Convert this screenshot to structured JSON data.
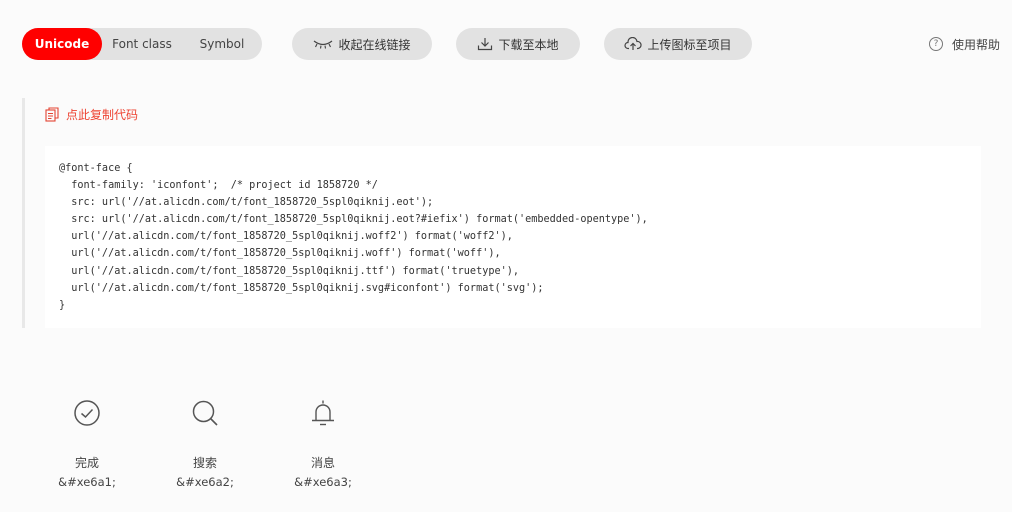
{
  "toolbar": {
    "tabs": [
      {
        "label": "Unicode",
        "active": true
      },
      {
        "label": "Font class",
        "active": false
      },
      {
        "label": "Symbol",
        "active": false
      }
    ],
    "collapse_label": "收起在线链接",
    "download_label": "下载至本地",
    "upload_label": "上传图标至项目",
    "help_label": "使用帮助",
    "help_icon": "?"
  },
  "code_section": {
    "copy_label": "点此复制代码",
    "lines": [
      "@font-face {",
      "  font-family: 'iconfont';  /* project id 1858720 */",
      "  src: url('//at.alicdn.com/t/font_1858720_5spl0qiknij.eot');",
      "  src: url('//at.alicdn.com/t/font_1858720_5spl0qiknij.eot?#iefix') format('embedded-opentype'),",
      "  url('//at.alicdn.com/t/font_1858720_5spl0qiknij.woff2') format('woff2'),",
      "  url('//at.alicdn.com/t/font_1858720_5spl0qiknij.woff') format('woff'),",
      "  url('//at.alicdn.com/t/font_1858720_5spl0qiknij.ttf') format('truetype'),",
      "  url('//at.alicdn.com/t/font_1858720_5spl0qiknij.svg#iconfont') format('svg');",
      "}"
    ]
  },
  "icons": [
    {
      "icon": "check-circle-icon",
      "name": "完成",
      "code": "&#xe6a1;"
    },
    {
      "icon": "search-icon",
      "name": "搜索",
      "code": "&#xe6a2;"
    },
    {
      "icon": "bell-icon",
      "name": "消息",
      "code": "&#xe6a3;"
    }
  ],
  "colors": {
    "accent": "#ff0000",
    "copy_link": "#e44433",
    "button_bg": "#e2e2e2"
  }
}
